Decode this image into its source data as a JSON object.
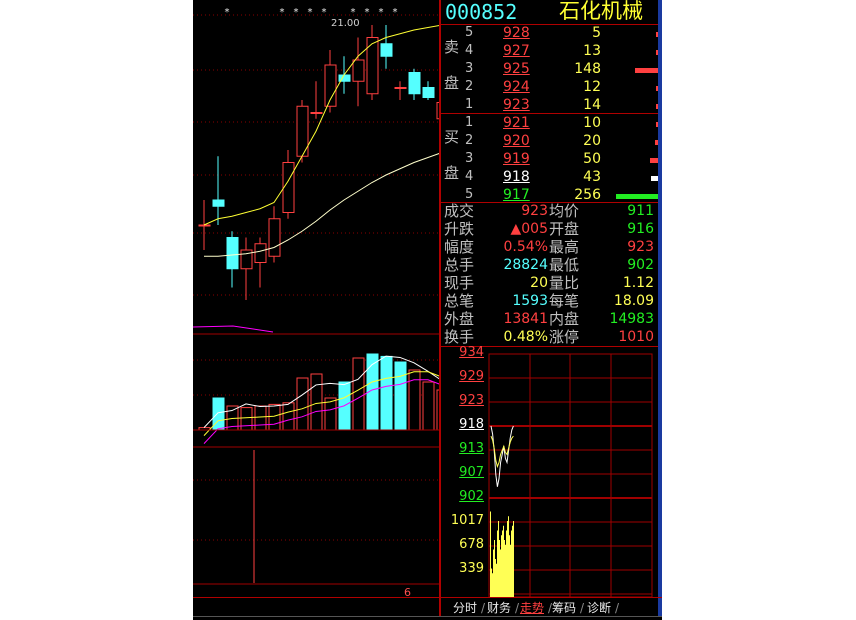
{
  "colors": {
    "up": "#ff4040",
    "down": "#55ffff",
    "flat": "#ffffff",
    "yellow": "#ffff55",
    "green": "#22ee22",
    "grid": "#a00000",
    "label": "#c0c0c0",
    "ma": "#ffff33",
    "ma2": "#ffffcc",
    "pink": "#ff00ff"
  },
  "stock": {
    "code": "000852",
    "name": "石化机械"
  },
  "kline": {
    "high_label": "21.00",
    "bottom_tick": "6",
    "stars": [
      0,
      1,
      2,
      3,
      4,
      5,
      6,
      7,
      8,
      9,
      10,
      11,
      12,
      13,
      14
    ],
    "star_marks": [
      "*",
      "*",
      "*",
      "*",
      "*",
      "*",
      "*",
      "*",
      "*"
    ],
    "candles": [
      {
        "o": 19.4,
        "h": 19.6,
        "l": 19.2,
        "c": 19.4
      },
      {
        "o": 19.6,
        "h": 19.95,
        "l": 19.4,
        "c": 19.55
      },
      {
        "o": 19.3,
        "h": 19.35,
        "l": 18.9,
        "c": 19.05
      },
      {
        "o": 19.05,
        "h": 19.3,
        "l": 18.8,
        "c": 19.2
      },
      {
        "o": 19.1,
        "h": 19.3,
        "l": 18.9,
        "c": 19.25
      },
      {
        "o": 19.15,
        "h": 19.55,
        "l": 19.1,
        "c": 19.45
      },
      {
        "o": 19.5,
        "h": 20.0,
        "l": 19.45,
        "c": 19.9
      },
      {
        "o": 19.95,
        "h": 20.4,
        "l": 19.9,
        "c": 20.35
      },
      {
        "o": 20.3,
        "h": 20.55,
        "l": 20.25,
        "c": 20.3
      },
      {
        "o": 20.35,
        "h": 20.8,
        "l": 20.3,
        "c": 20.68
      },
      {
        "o": 20.6,
        "h": 20.75,
        "l": 20.45,
        "c": 20.55
      },
      {
        "o": 20.55,
        "h": 20.9,
        "l": 20.35,
        "c": 20.72
      },
      {
        "o": 20.45,
        "h": 21.0,
        "l": 20.4,
        "c": 20.9
      },
      {
        "o": 20.85,
        "h": 21.0,
        "l": 20.65,
        "c": 20.75
      },
      {
        "o": 20.5,
        "h": 20.55,
        "l": 20.4,
        "c": 20.5
      },
      {
        "o": 20.62,
        "h": 20.65,
        "l": 20.4,
        "c": 20.45
      },
      {
        "o": 20.5,
        "h": 20.55,
        "l": 20.4,
        "c": 20.42
      },
      {
        "o": 20.25,
        "h": 20.5,
        "l": 20.2,
        "c": 20.38
      },
      {
        "o": 20.35,
        "h": 20.55,
        "l": 20.3,
        "c": 20.45
      }
    ],
    "ma1": [
      19.4,
      19.45,
      19.47,
      19.5,
      19.53,
      19.58,
      19.75,
      19.95,
      20.15,
      20.4,
      20.6,
      20.75,
      20.85,
      20.9,
      20.93,
      20.96,
      20.98,
      21.0,
      21.0
    ],
    "ma2": [
      19.15,
      19.15,
      19.16,
      19.17,
      19.19,
      19.22,
      19.28,
      19.35,
      19.43,
      19.52,
      19.6,
      19.67,
      19.74,
      19.8,
      19.85,
      19.9,
      19.94,
      19.98,
      20.02
    ],
    "volumes": [
      3,
      40,
      30,
      28,
      30,
      32,
      34,
      65,
      70,
      40,
      60,
      90,
      95,
      92,
      85,
      75,
      60,
      50,
      55
    ],
    "vol_up": [
      true,
      false,
      true,
      true,
      true,
      true,
      true,
      true,
      true,
      true,
      false,
      true,
      false,
      false,
      false,
      true,
      true,
      true,
      true
    ]
  },
  "orderbook": {
    "sell_label_1": "卖",
    "sell_label_2": "盘",
    "buy_label_1": "买",
    "buy_label_2": "盘",
    "sell": [
      {
        "level": "5",
        "price": "928",
        "vol": "5",
        "bar": 0.02
      },
      {
        "level": "4",
        "price": "927",
        "vol": "13",
        "bar": 0.04
      },
      {
        "level": "3",
        "price": "925",
        "vol": "148",
        "bar": 0.55
      },
      {
        "level": "2",
        "price": "924",
        "vol": "12",
        "bar": 0.04
      },
      {
        "level": "1",
        "price": "923",
        "vol": "14",
        "bar": 0.05
      }
    ],
    "buy": [
      {
        "level": "1",
        "price": "921",
        "vol": "10",
        "bar": 0.04,
        "color": "up"
      },
      {
        "level": "2",
        "price": "920",
        "vol": "20",
        "bar": 0.08,
        "color": "up"
      },
      {
        "level": "3",
        "price": "919",
        "vol": "50",
        "bar": 0.2,
        "color": "up"
      },
      {
        "level": "4",
        "price": "918",
        "vol": "43",
        "bar": 0.17,
        "color": "flat"
      },
      {
        "level": "5",
        "price": "917",
        "vol": "256",
        "bar": 1.0,
        "color": "green"
      }
    ]
  },
  "stats": [
    {
      "l1": "成交",
      "v1": "923",
      "c1": "up",
      "l2": "均价",
      "v2": "911",
      "c2": "green"
    },
    {
      "l1": "升跌",
      "v1": "▲005",
      "c1": "up",
      "l2": "开盘",
      "v2": "916",
      "c2": "green"
    },
    {
      "l1": "幅度",
      "v1": "0.54%",
      "c1": "up",
      "l2": "最高",
      "v2": "923",
      "c2": "up"
    },
    {
      "l1": "总手",
      "v1": "28824",
      "c1": "down",
      "l2": "最低",
      "v2": "902",
      "c2": "green"
    },
    {
      "l1": "现手",
      "v1": "20",
      "c1": "yellow",
      "l2": "量比",
      "v2": "1.12",
      "c2": "yellow"
    },
    {
      "l1": "总笔",
      "v1": "1593",
      "c1": "down",
      "l2": "每笔",
      "v2": "18.09",
      "c2": "yellow"
    },
    {
      "l1": "外盘",
      "v1": "13841",
      "c1": "up",
      "l2": "内盘",
      "v2": "14983",
      "c2": "green"
    },
    {
      "l1": "换手",
      "v1": "0.48%",
      "c1": "yellow",
      "l2": "涨停",
      "v2": "1010",
      "c2": "up"
    }
  ],
  "intraday": {
    "price_ticks": [
      {
        "v": "934",
        "c": "up"
      },
      {
        "v": "929",
        "c": "up"
      },
      {
        "v": "923",
        "c": "up"
      },
      {
        "v": "918",
        "c": "flat"
      },
      {
        "v": "913",
        "c": "green"
      },
      {
        "v": "907",
        "c": "green"
      },
      {
        "v": "902",
        "c": "green"
      }
    ],
    "vol_ticks": [
      "1017",
      "678",
      "339"
    ],
    "price_line": [
      918,
      916,
      912,
      906,
      903,
      905,
      909,
      911,
      913,
      910,
      909,
      912,
      915,
      917,
      918
    ],
    "volumes": [
      0.9,
      0.3,
      0.25,
      0.5,
      0.6,
      0.4,
      0.35,
      0.7,
      0.8,
      0.6,
      0.5,
      0.65,
      0.7,
      0.75,
      0.6,
      0.55,
      0.7,
      0.8,
      0.85,
      0.65,
      0.55,
      0.7,
      0.75,
      0.8
    ]
  },
  "tabs": [
    "分时",
    "财务",
    "走势",
    "筹码",
    "诊断"
  ],
  "active_tab": 2
}
